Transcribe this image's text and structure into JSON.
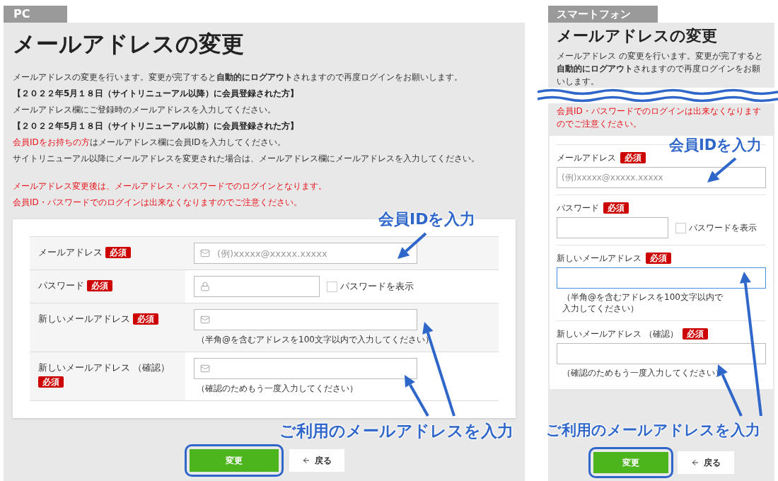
{
  "pc": {
    "tab": "PC",
    "title": "メールアドレスの変更",
    "field_icons": true,
    "intro": [
      {
        "kind": "text",
        "text": "メールアドレスの変更を行います。変更が完了すると**自動的にログアウト**されますので再度ログインをお願いします。"
      },
      {
        "kind": "heading",
        "text": "【２０２２年5月１８日（サイトリニューアル以降）に会員登録された方】"
      },
      {
        "kind": "text",
        "text": "メールアドレス欄にご登録時のメールアドレスを入力してください。"
      },
      {
        "kind": "heading",
        "text": "【２０２２年5月１８日（サイトリニューアル以前）に会員登録された方】"
      },
      {
        "kind": "mixed",
        "parts": [
          {
            "text": "会員IDをお持ちの方",
            "red": true
          },
          {
            "text": "はメールアドレス欄に会員IDを入力してください。",
            "red": false
          }
        ]
      },
      {
        "kind": "text",
        "text": "サイトリニューアル以降にメールアドレスを変更された場合は、メールアドレス欄にメールアドレスを入力してください。"
      }
    ],
    "notices": [
      "メールアドレス変更後は、メールアドレス・パスワードでのログインとなります。",
      "会員ID・パスワードでのログインは出来なくなりますのでご注意ください。"
    ],
    "form": [
      {
        "label": "メールアドレス",
        "required": true,
        "badge": "必須",
        "input": {
          "kind": "email",
          "placeholder": "(例)xxxxx@xxxxx.xxxxx",
          "focused": false
        }
      },
      {
        "label": "パスワード",
        "required": true,
        "badge": "必須",
        "input": {
          "kind": "password",
          "focused": false
        },
        "show_password": {
          "label": "パスワードを表示",
          "checked": false
        }
      },
      {
        "label": "新しいメールアドレス",
        "required": true,
        "badge": "必須",
        "input": {
          "kind": "email",
          "focused": false
        },
        "hint": "（半角@を含むアドレスを100文字以内で入力してください）"
      },
      {
        "label": "新しいメールアドレス （確認）",
        "required": true,
        "badge": "必須",
        "input": {
          "kind": "email",
          "focused": false
        },
        "hint": "（確認のためもう一度入力してください）"
      }
    ],
    "submit": {
      "label": "変更",
      "highlighted": true
    },
    "back": "戻る",
    "callouts": [
      {
        "text": "会員IDを入力"
      },
      {
        "text": "ご利用のメールアドレスを入力"
      }
    ]
  },
  "sp": {
    "tab": "スマートフォン",
    "title": "メールアドレスの変更",
    "field_icons": false,
    "intro": [
      {
        "kind": "text",
        "text": "メールアドレス の変更を行います。変更が完了すると**自動的にログアウト**されますので再度ログインをお願いします。"
      }
    ],
    "notices": [
      "会員ID・パスワードでのログインは出来なくなりますのでご注意ください。"
    ],
    "form": [
      {
        "label": "メールアドレス",
        "required": true,
        "badge": "必須",
        "input": {
          "kind": "email",
          "placeholder": "(例)xxxxx@xxxxx.xxxxx",
          "focused": false
        }
      },
      {
        "label": "パスワード",
        "required": true,
        "badge": "必須",
        "input": {
          "kind": "password",
          "focused": false
        },
        "show_password": {
          "label": "パスワードを表示",
          "checked": false
        }
      },
      {
        "label": "新しいメールアドレス",
        "required": true,
        "badge": "必須",
        "input": {
          "kind": "email",
          "focused": true
        },
        "hint": "（半角@を含むアドレスを100文字以内で入力してください）"
      },
      {
        "label": "新しいメールアドレス （確認）",
        "required": true,
        "badge": "必須",
        "input": {
          "kind": "email",
          "focused": false
        },
        "hint": "（確認のためもう一度入力してください）"
      }
    ],
    "submit": {
      "label": "変更",
      "highlighted": true
    },
    "back": "戻る",
    "callouts": [
      {
        "text": "会員IDを入力"
      },
      {
        "text": "ご利用のメールアドレスを入力"
      }
    ]
  }
}
